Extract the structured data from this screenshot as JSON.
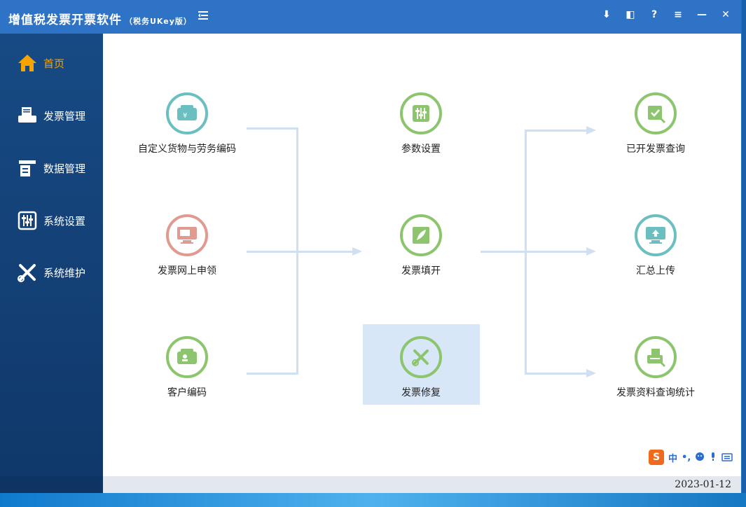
{
  "titlebar": {
    "title": "增值税发票开票软件",
    "subtitle": "（税务UKey版）",
    "menu_icon": "sidebar-collapse-icon",
    "controls": [
      {
        "name": "download",
        "glyph": "⬇"
      },
      {
        "name": "restore",
        "glyph": "◧"
      },
      {
        "name": "help",
        "glyph": "?"
      },
      {
        "name": "menu",
        "glyph": "≡"
      },
      {
        "name": "minimize",
        "glyph": "—"
      },
      {
        "name": "close",
        "glyph": "✕"
      }
    ]
  },
  "sidebar": {
    "items": [
      {
        "label": "首页",
        "icon": "home-icon",
        "active": true
      },
      {
        "label": "发票管理",
        "icon": "invoice-printer-icon"
      },
      {
        "label": "数据管理",
        "icon": "data-management-icon"
      },
      {
        "label": "系统设置",
        "icon": "settings-sliders-icon"
      },
      {
        "label": "系统维护",
        "icon": "tools-icon"
      }
    ]
  },
  "flow": {
    "left": [
      {
        "label": "自定义货物与劳务编码",
        "icon": "goods-wallet-icon",
        "color": "#6bbfc0"
      },
      {
        "label": "发票网上申领",
        "icon": "monitor-apply-icon",
        "color": "#e19a8f"
      },
      {
        "label": "客户编码",
        "icon": "customer-card-icon",
        "color": "#8cc56d"
      }
    ],
    "middle": [
      {
        "label": "参数设置",
        "icon": "parameter-sliders-icon",
        "color": "#8cc56d"
      },
      {
        "label": "发票填开",
        "icon": "feather-icon",
        "color": "#8cc56d"
      },
      {
        "label": "发票修复",
        "icon": "repair-tools-icon",
        "color": "#8cc56d",
        "highlighted": true
      }
    ],
    "right": [
      {
        "label": "已开发票查询",
        "icon": "invoice-search-icon",
        "color": "#8cc56d"
      },
      {
        "label": "汇总上传",
        "icon": "upload-monitor-icon",
        "color": "#6bbfc0"
      },
      {
        "label": "发票资料查询统计",
        "icon": "printer-stats-icon",
        "color": "#8cc56d"
      }
    ]
  },
  "ime": {
    "logo": "S",
    "mode": "中",
    "symbols": "•,",
    "icons": [
      "emoji-icon",
      "microphone-icon",
      "keyboard-icon"
    ]
  },
  "status": {
    "date": "2023-01-12"
  },
  "colors": {
    "titlebar": "#2e73c5",
    "sidebar": "#174a84",
    "active": "#f6a400",
    "flow_line": "#cfe0f3",
    "highlight": "#d8e7f8"
  }
}
